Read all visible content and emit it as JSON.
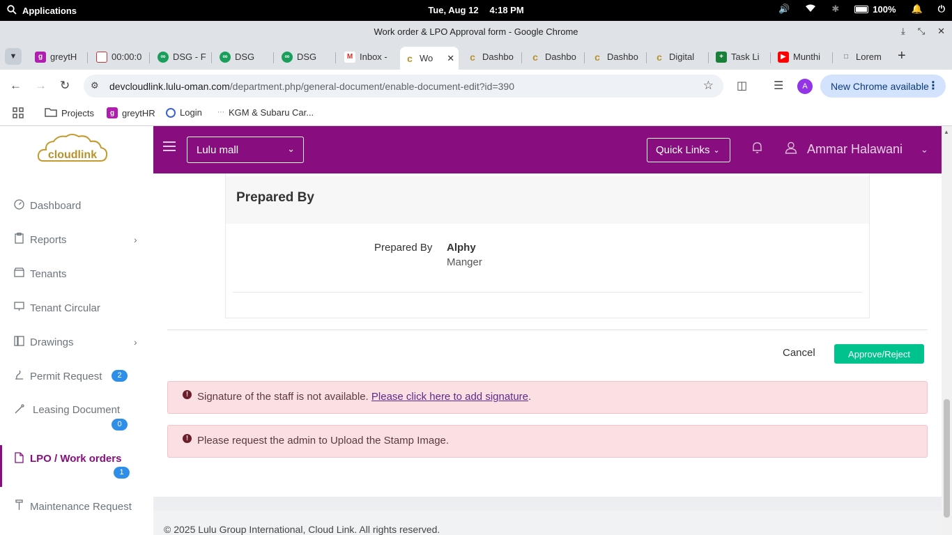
{
  "os": {
    "apps_label": "Applications",
    "date": "Tue, Aug 12",
    "time": "4:18 PM",
    "battery": "100%"
  },
  "browser": {
    "window_title": "Work order & LPO Approval form - Google Chrome",
    "tabs": [
      {
        "label": "greytH",
        "favicon": "greythr"
      },
      {
        "label": "00:00:0",
        "favicon": "timer"
      },
      {
        "label": "DSG - F",
        "favicon": "dsg"
      },
      {
        "label": "DSG",
        "favicon": "dsg"
      },
      {
        "label": "DSG",
        "favicon": "dsg"
      },
      {
        "label": "Inbox -",
        "favicon": "gmail"
      },
      {
        "label": "Wo",
        "favicon": "cloudlink",
        "active": true
      },
      {
        "label": "Dashbo",
        "favicon": "cloudlink"
      },
      {
        "label": "Dashbo",
        "favicon": "cloudlink"
      },
      {
        "label": "Dashbo",
        "favicon": "cloudlink"
      },
      {
        "label": "Digital",
        "favicon": "cloudlink"
      },
      {
        "label": "Task Li",
        "favicon": "sheets"
      },
      {
        "label": "Munthi",
        "favicon": "youtube"
      },
      {
        "label": "Lorem",
        "favicon": "doc"
      }
    ],
    "url_host": "devcloudlink.lulu-oman.com",
    "url_path": "/department.php/general-document/enable-document-edit?id=390",
    "profile_initial": "A",
    "update_label": "New Chrome available",
    "bookmarks": [
      {
        "label": "Projects",
        "icon": "folder-icon"
      },
      {
        "label": "greytHR",
        "icon": "greythr-icon"
      },
      {
        "label": "Login",
        "icon": "login-icon"
      },
      {
        "label": "KGM & Subaru Car...",
        "icon": "dots-icon"
      }
    ]
  },
  "app": {
    "logo_text": "cloudlink",
    "mall_select": "Lulu mall",
    "quick_links": "Quick Links",
    "user_name": "Ammar Halawani",
    "brand_color": "#880e7f",
    "sidebar": [
      {
        "label": "Dashboard",
        "icon": "dashboard-icon"
      },
      {
        "label": "Reports",
        "icon": "clipboard-icon",
        "has_children": true
      },
      {
        "label": "Tenants",
        "icon": "store-icon"
      },
      {
        "label": "Tenant Circular",
        "icon": "presentation-icon"
      },
      {
        "label": "Drawings",
        "icon": "drawing-icon",
        "has_children": true
      },
      {
        "label": "Permit Request",
        "icon": "permit-icon",
        "badge": "2"
      },
      {
        "label": "Leasing Document",
        "icon": "pen-icon",
        "badge": "0"
      },
      {
        "label": "LPO / Work orders",
        "icon": "file-icon",
        "badge": "1",
        "active": true
      },
      {
        "label": "Maintenance Request",
        "icon": "wrench-icon"
      }
    ],
    "section_title": "Prepared By",
    "prepared_by_label": "Prepared By",
    "prepared_by_name": "Alphy",
    "prepared_by_role": "Manger",
    "cancel_label": "Cancel",
    "approve_label": "Approve/Reject",
    "alert1_text": "Signature of the staff is not available. ",
    "alert1_link": "Please click here to add signature",
    "alert1_tail": ".",
    "alert2_text": "Please request the admin to Upload the Stamp Image.",
    "footer": "© 2025 Lulu Group International, Cloud Link. All rights reserved."
  }
}
